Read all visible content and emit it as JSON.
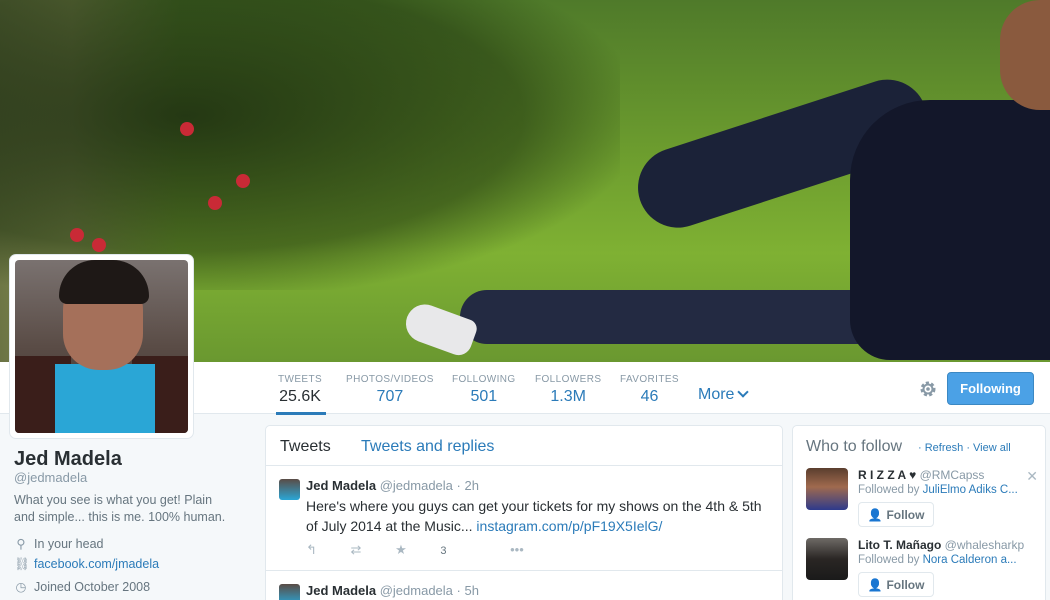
{
  "profile": {
    "name": "Jed Madela",
    "handle": "@jedmadela",
    "bio": "What you see is what you get! Plain and simple... this is me. 100% human.",
    "location": "In your head",
    "website": "facebook.com/jmadela",
    "joined": "Joined October 2008"
  },
  "nav": {
    "stats": [
      {
        "label": "TWEETS",
        "value": "25.6K"
      },
      {
        "label": "PHOTOS/VIDEOS",
        "value": "707"
      },
      {
        "label": "FOLLOWING",
        "value": "501"
      },
      {
        "label": "FOLLOWERS",
        "value": "1.3M"
      },
      {
        "label": "FAVORITES",
        "value": "46"
      }
    ],
    "more_label": "More",
    "follow_button": "Following"
  },
  "timeline": {
    "tabs": [
      "Tweets",
      "Tweets and replies"
    ],
    "tweets": [
      {
        "name": "Jed Madela",
        "handle": "@jedmadela",
        "time": "· 2h",
        "text": "Here's where you guys can get your tickets for my shows on the 4th & 5th of July 2014 at the Music... ",
        "link": "instagram.com/p/pF19X5IelG/",
        "favorites": "3"
      },
      {
        "name": "Jed Madela",
        "handle": "@jedmadela",
        "time": "· 5h"
      }
    ]
  },
  "who_to_follow": {
    "title": "Who to follow",
    "refresh": "· Refresh",
    "view_all": "· View all",
    "follow_label": "Follow",
    "suggestions": [
      {
        "name": "R I Z Z A ♥",
        "handle": "@RMCapss",
        "followed_by_prefix": "Followed by",
        "followed_by": "JuliElmo Adiks C..."
      },
      {
        "name": "Lito T. Mañago",
        "handle": "@whalesharkp",
        "followed_by_prefix": "Followed by",
        "followed_by": "Nora Calderon a..."
      }
    ]
  },
  "colors": {
    "accent": "#2b7bb9",
    "button": "#4ba1e6",
    "muted": "#8899a6"
  }
}
